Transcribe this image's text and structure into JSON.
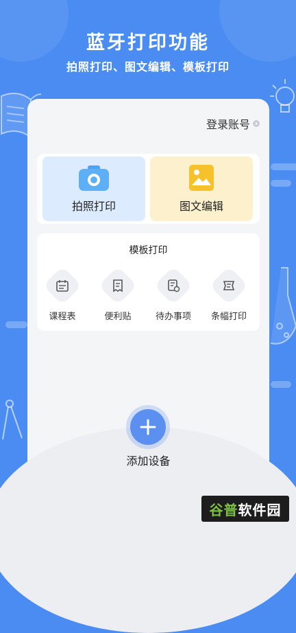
{
  "header": {
    "title": "蓝牙打印功能",
    "subtitle": "拍照打印、图文编辑、模板打印"
  },
  "account": {
    "login_label": "登录账号"
  },
  "features": {
    "photo_print": {
      "label": "拍照打印",
      "icon": "camera-icon"
    },
    "image_text_edit": {
      "label": "图文编辑",
      "icon": "image-icon"
    }
  },
  "templates": {
    "title": "模板打印",
    "items": [
      {
        "label": "课程表",
        "icon": "calendar-icon"
      },
      {
        "label": "便利贴",
        "icon": "sticky-note-icon"
      },
      {
        "label": "待办事项",
        "icon": "todo-list-icon"
      },
      {
        "label": "条幅打印",
        "icon": "banner-icon"
      }
    ]
  },
  "device": {
    "add_label": "添加设备",
    "icon": "plus-icon"
  },
  "watermark": {
    "part1": "谷普",
    "part2": "软件园"
  },
  "colors": {
    "background": "#4a8cf2",
    "accent": "#5b8ff0",
    "photo_tile": "#dcebfd",
    "edit_tile": "#fdf0cc"
  }
}
